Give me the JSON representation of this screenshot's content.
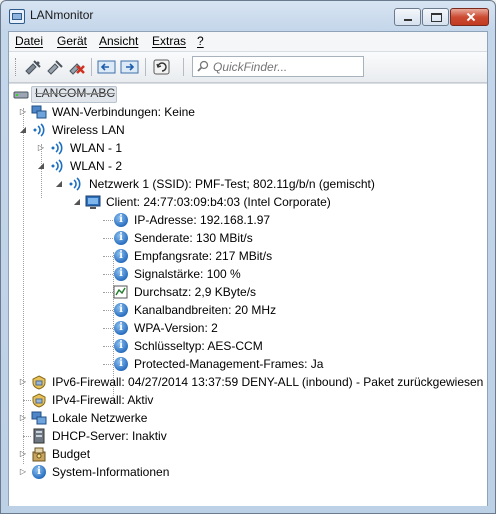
{
  "window": {
    "title": "LANmonitor"
  },
  "menu": [
    {
      "label": "Datei"
    },
    {
      "label": "Gerät"
    },
    {
      "label": "Ansicht"
    },
    {
      "label": "Extras"
    },
    {
      "label": "?"
    }
  ],
  "toolbar": {
    "quickfinder_placeholder": "QuickFinder..."
  },
  "tree": {
    "device_label": "LANCOM-ABC",
    "wan": "WAN-Verbindungen: Keine",
    "wlan": "Wireless LAN",
    "wlan1": "WLAN - 1",
    "wlan2": "WLAN - 2",
    "network1": "Netzwerk 1 (SSID): PMF-Test; 802.11g/b/n (gemischt)",
    "client": "Client: 24:77:03:09:b4:03 (Intel Corporate)",
    "ip": "IP-Adresse: 192.168.1.97",
    "send": "Senderate: 130 MBit/s",
    "recv": "Empfangsrate: 217 MBit/s",
    "signal": "Signalstärke: 100 %",
    "throughput": "Durchsatz: 2,9 KByte/s",
    "channel": "Kanalbandbreiten: 20 MHz",
    "wpa": "WPA-Version: 2",
    "key": "Schlüsseltyp: AES-CCM",
    "pmf": "Protected-Management-Frames: Ja",
    "ipv6fw": "IPv6-Firewall: 04/27/2014 13:37:59 DENY-ALL (inbound) - Paket zurückgewiesen",
    "ipv4fw": "IPv4-Firewall: Aktiv",
    "lan": "Lokale Netzwerke",
    "dhcp": "DHCP-Server: Inaktiv",
    "budget": "Budget",
    "sysinfo": "System-Informationen"
  }
}
